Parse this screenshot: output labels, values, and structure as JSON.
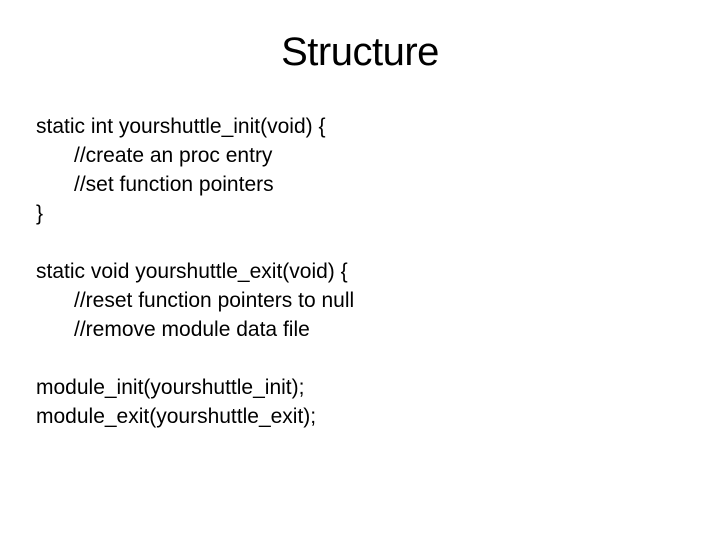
{
  "title": "Structure",
  "block1": {
    "line1": "static int yourshuttle_init(void) {",
    "line2": "//create an proc entry",
    "line3": "//set function pointers",
    "line4": "}"
  },
  "block2": {
    "line1": "static void yourshuttle_exit(void) {",
    "line2": "//reset function pointers to null",
    "line3": "//remove module data file"
  },
  "block3": {
    "line1": "module_init(yourshuttle_init);",
    "line2": "module_exit(yourshuttle_exit);"
  }
}
